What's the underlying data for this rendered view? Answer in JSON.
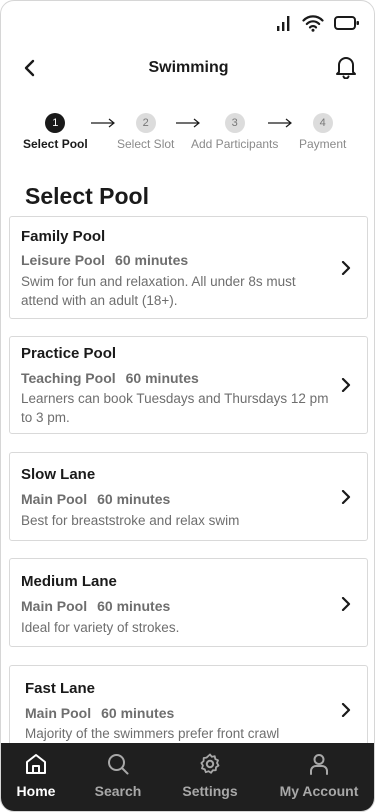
{
  "header": {
    "title": "Swimming"
  },
  "stepper": {
    "steps": [
      {
        "number": "1",
        "label": "Select Pool",
        "active": true
      },
      {
        "number": "2",
        "label": "Select Slot",
        "active": false
      },
      {
        "number": "3",
        "label": "Add Participants",
        "active": false
      },
      {
        "number": "4",
        "label": "Payment",
        "active": false
      }
    ]
  },
  "section": {
    "title": "Select Pool"
  },
  "pools": [
    {
      "name": "Family Pool",
      "type": "Leisure Pool",
      "duration": "60 minutes",
      "description": "Swim for fun and relaxation. All under 8s must attend with an adult (18+)."
    },
    {
      "name": "Practice Pool",
      "type": "Teaching Pool",
      "duration": "60 minutes",
      "description": "Learners can book Tuesdays and Thursdays 12 pm to 3 pm."
    },
    {
      "name": "Slow Lane",
      "type": "Main Pool",
      "duration": "60 minutes",
      "description": "Best for breaststroke and relax swim"
    },
    {
      "name": "Medium Lane",
      "type": "Main Pool",
      "duration": "60 minutes",
      "description": "Ideal for variety of strokes."
    },
    {
      "name": "Fast Lane",
      "type": "Main Pool",
      "duration": "60 minutes",
      "description": "Majority of the swimmers prefer front crawl"
    }
  ],
  "nav": {
    "items": [
      {
        "label": "Home",
        "icon": "home-icon",
        "active": true
      },
      {
        "label": "Search",
        "icon": "search-icon",
        "active": false
      },
      {
        "label": "Settings",
        "icon": "gear-icon",
        "active": false
      },
      {
        "label": "My Account",
        "icon": "user-icon",
        "active": false
      }
    ]
  },
  "colors": {
    "primary": "#1a1a1a",
    "muted": "#6e6e6e",
    "nav_background": "#1f1f1f",
    "step_inactive": "#dcdcdc"
  }
}
